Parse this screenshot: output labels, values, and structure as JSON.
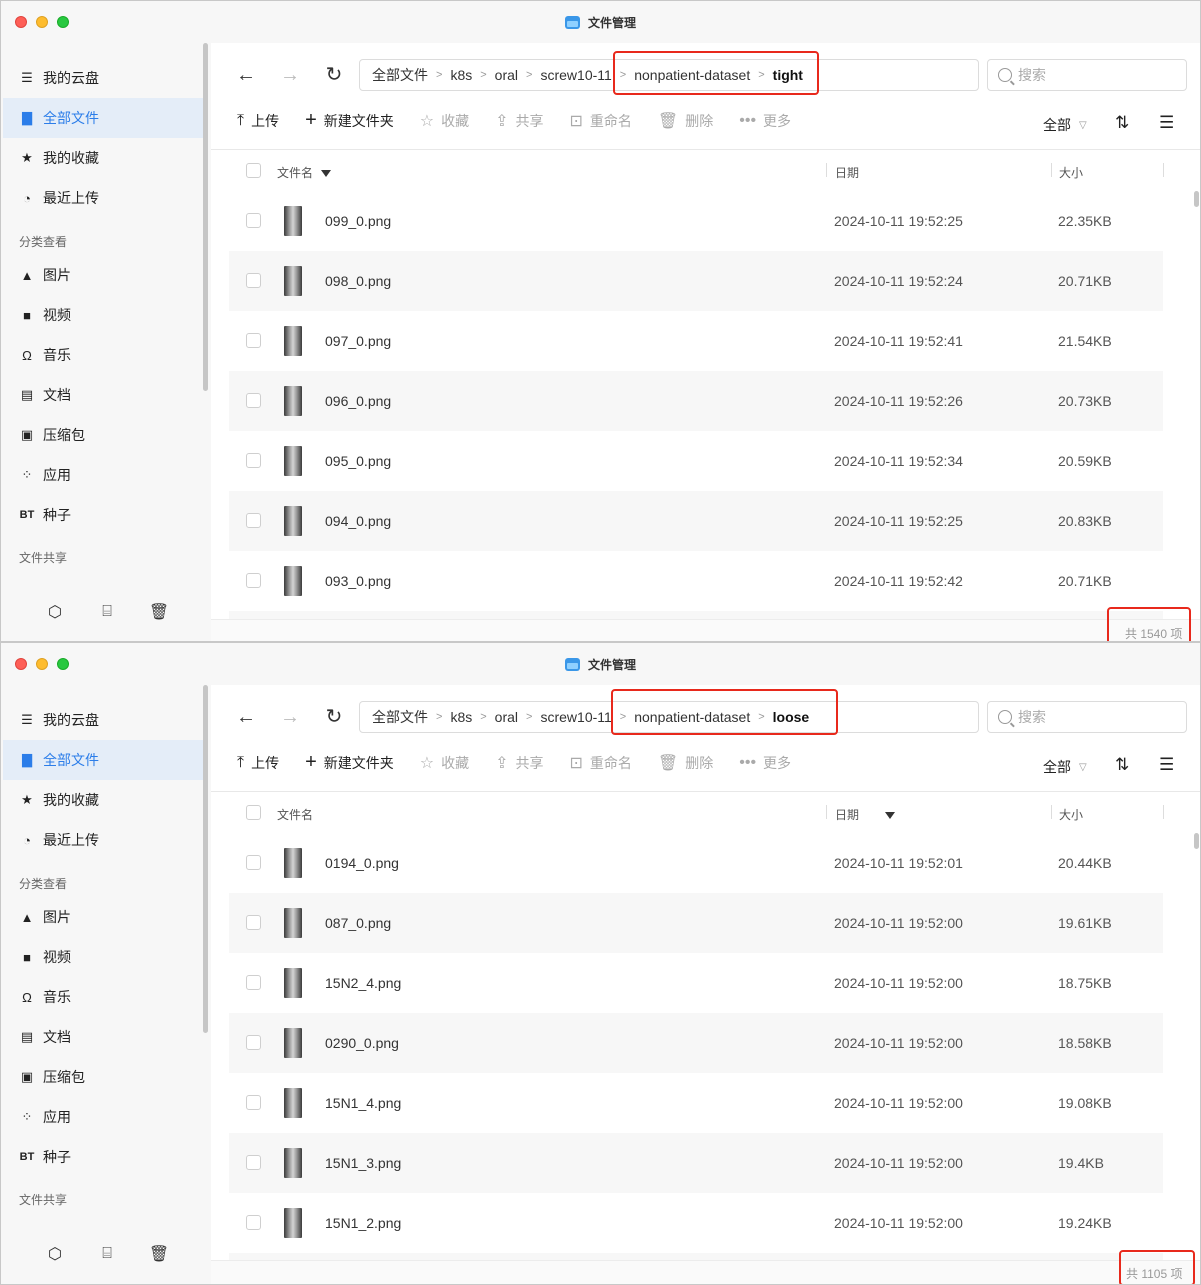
{
  "windows": [
    {
      "title": "文件管理",
      "sidebar": {
        "items": [
          {
            "label": "我的云盘",
            "icon": "storage-icon"
          },
          {
            "label": "全部文件",
            "icon": "file-icon",
            "active": true
          },
          {
            "label": "我的收藏",
            "icon": "star-icon"
          },
          {
            "label": "最近上传",
            "icon": "clock-icon"
          }
        ],
        "section_category": "分类查看",
        "categories": [
          {
            "label": "图片",
            "icon": "image-icon"
          },
          {
            "label": "视频",
            "icon": "video-icon"
          },
          {
            "label": "音乐",
            "icon": "headphones-icon"
          },
          {
            "label": "文档",
            "icon": "document-icon"
          },
          {
            "label": "压缩包",
            "icon": "archive-icon"
          },
          {
            "label": "应用",
            "icon": "apps-icon"
          },
          {
            "label": "种子",
            "icon": "bt-icon",
            "icon_text": "BT"
          }
        ],
        "section_share": "文件共享"
      },
      "breadcrumb": [
        "全部文件",
        "k8s",
        "oral",
        "screw10-11",
        "nonpatient-dataset",
        "tight"
      ],
      "search_placeholder": "搜索",
      "toolbar": {
        "upload": "上传",
        "new_folder": "新建文件夹",
        "favorite": "收藏",
        "share": "共享",
        "rename": "重命名",
        "delete": "删除",
        "more": "更多"
      },
      "filter": "全部",
      "columns": {
        "name": "文件名",
        "date": "日期",
        "size": "大小"
      },
      "sort_column": "name",
      "files": [
        {
          "name": "099_0.png",
          "date": "2024-10-11 19:52:25",
          "size": "22.35KB"
        },
        {
          "name": "098_0.png",
          "date": "2024-10-11 19:52:24",
          "size": "20.71KB"
        },
        {
          "name": "097_0.png",
          "date": "2024-10-11 19:52:41",
          "size": "21.54KB"
        },
        {
          "name": "096_0.png",
          "date": "2024-10-11 19:52:26",
          "size": "20.73KB"
        },
        {
          "name": "095_0.png",
          "date": "2024-10-11 19:52:34",
          "size": "20.59KB"
        },
        {
          "name": "094_0.png",
          "date": "2024-10-11 19:52:25",
          "size": "20.83KB"
        },
        {
          "name": "093_0.png",
          "date": "2024-10-11 19:52:42",
          "size": "20.71KB"
        }
      ],
      "count": "共 1540 项"
    },
    {
      "title": "文件管理",
      "sidebar": {
        "items": [
          {
            "label": "我的云盘",
            "icon": "storage-icon"
          },
          {
            "label": "全部文件",
            "icon": "file-icon",
            "active": true
          },
          {
            "label": "我的收藏",
            "icon": "star-icon"
          },
          {
            "label": "最近上传",
            "icon": "clock-icon"
          }
        ],
        "section_category": "分类查看",
        "categories": [
          {
            "label": "图片",
            "icon": "image-icon"
          },
          {
            "label": "视频",
            "icon": "video-icon"
          },
          {
            "label": "音乐",
            "icon": "headphones-icon"
          },
          {
            "label": "文档",
            "icon": "document-icon"
          },
          {
            "label": "压缩包",
            "icon": "archive-icon"
          },
          {
            "label": "应用",
            "icon": "apps-icon"
          },
          {
            "label": "种子",
            "icon": "bt-icon",
            "icon_text": "BT"
          }
        ],
        "section_share": "文件共享"
      },
      "breadcrumb": [
        "全部文件",
        "k8s",
        "oral",
        "screw10-11",
        "nonpatient-dataset",
        "loose"
      ],
      "search_placeholder": "搜索",
      "toolbar": {
        "upload": "上传",
        "new_folder": "新建文件夹",
        "favorite": "收藏",
        "share": "共享",
        "rename": "重命名",
        "delete": "删除",
        "more": "更多"
      },
      "filter": "全部",
      "columns": {
        "name": "文件名",
        "date": "日期",
        "size": "大小"
      },
      "sort_column": "date",
      "files": [
        {
          "name": "0194_0.png",
          "date": "2024-10-11 19:52:01",
          "size": "20.44KB"
        },
        {
          "name": "087_0.png",
          "date": "2024-10-11 19:52:00",
          "size": "19.61KB"
        },
        {
          "name": "15N2_4.png",
          "date": "2024-10-11 19:52:00",
          "size": "18.75KB"
        },
        {
          "name": "0290_0.png",
          "date": "2024-10-11 19:52:00",
          "size": "18.58KB"
        },
        {
          "name": "15N1_4.png",
          "date": "2024-10-11 19:52:00",
          "size": "19.08KB"
        },
        {
          "name": "15N1_3.png",
          "date": "2024-10-11 19:52:00",
          "size": "19.4KB"
        },
        {
          "name": "15N1_2.png",
          "date": "2024-10-11 19:52:00",
          "size": "19.24KB"
        }
      ],
      "count": "共 1105 项"
    }
  ]
}
